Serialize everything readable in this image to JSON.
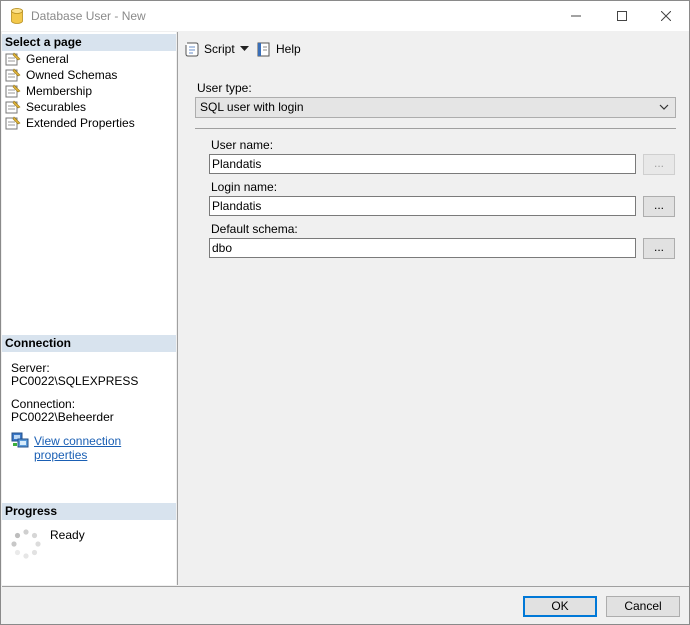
{
  "window": {
    "title": "Database User - New",
    "minimize_glyph": "—",
    "maximize_glyph": "☐",
    "close_glyph": "✕"
  },
  "left_pane": {
    "select_page_header": "Select a page",
    "pages": [
      {
        "label": "General",
        "icon": "page-wrench-icon"
      },
      {
        "label": "Owned Schemas",
        "icon": "page-wrench-icon"
      },
      {
        "label": "Membership",
        "icon": "page-wrench-icon"
      },
      {
        "label": "Securables",
        "icon": "page-wrench-icon"
      },
      {
        "label": "Extended Properties",
        "icon": "page-wrench-icon"
      }
    ],
    "connection_header": "Connection",
    "server_label": "Server:",
    "server_value": "PC0022\\SQLEXPRESS",
    "connection_label": "Connection:",
    "connection_value": "PC0022\\Beheerder",
    "view_connection_link": "View connection properties",
    "progress_header": "Progress",
    "progress_status": "Ready"
  },
  "toolbar": {
    "script_label": "Script",
    "help_label": "Help"
  },
  "form": {
    "user_type_label": "User type:",
    "user_type_value": "SQL user with login",
    "user_name_label": "User name:",
    "user_name_value": "Plandatis",
    "login_name_label": "Login name:",
    "login_name_value": "Plandatis",
    "default_schema_label": "Default schema:",
    "default_schema_value": "dbo",
    "browse_label": "..."
  },
  "footer": {
    "ok_label": "OK",
    "cancel_label": "Cancel"
  },
  "colors": {
    "header_bg": "#d8e3ee",
    "link": "#1a5fb4",
    "default_button_border": "#0078d7"
  }
}
